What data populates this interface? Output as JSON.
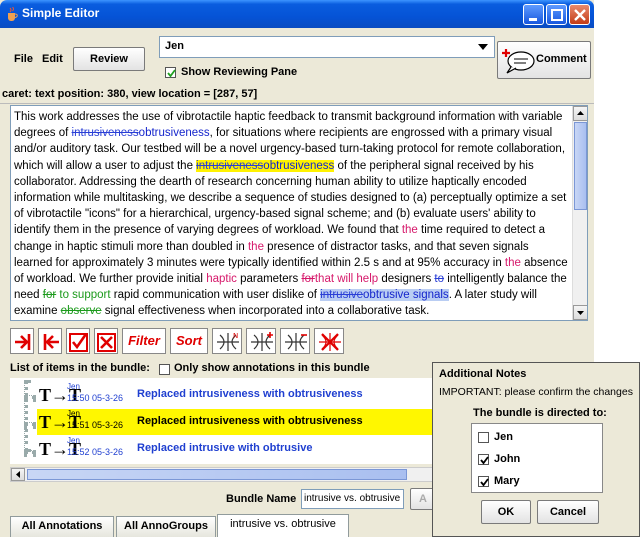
{
  "window": {
    "title": "Simple Editor"
  },
  "menu": {
    "file": "File",
    "edit": "Edit"
  },
  "toolbar": {
    "review_label": "Review",
    "user_select_value": "Jen",
    "show_reviewing_pane_label": "Show Reviewing Pane",
    "show_reviewing_pane_checked": true,
    "comment_label": "Comment"
  },
  "status": {
    "caret": "caret: text position: 380, view location = [287, 57]"
  },
  "editor": {
    "segments": [
      {
        "text": "This work addresses the use of vibrotactile haptic feedback to transmit background information with variable degrees of ",
        "style": "plain"
      },
      {
        "text": "intrusiveness",
        "style": "del"
      },
      {
        "text": "obtrusiveness",
        "style": "ins"
      },
      {
        "text": ", for situations where recipients are engrossed with a primary visual and/or auditory task. Our testbed will be a novel urgency-based turn-taking protocol for remote collaboration, which will allow a user to adjust the ",
        "style": "plain"
      },
      {
        "text": "intrusiveness",
        "style": "del-hl"
      },
      {
        "text": "obtrusiveness",
        "style": "ins-hl"
      },
      {
        "text": " of the peripheral signal received by his collaborator. Addressing the dearth of research concerning human ability to utilize haptically encoded information while multitasking, we describe a sequence of studies designed to (a) perceptually optimize a set of vibrotactile \"icons\" for a hierarchical, urgency-based signal scheme; and (b) evaluate users' ability to identify them in the presence of varying degrees of workload. We found that ",
        "style": "plain"
      },
      {
        "text": " the",
        "style": "mag"
      },
      {
        "text": " time required to detect a change in haptic stimuli more than doubled in ",
        "style": "plain"
      },
      {
        "text": " the",
        "style": "mag"
      },
      {
        "text": " presence of distractor tasks, and that seven signals learned for approximately 3 minutes were typically identified within 2.5 s and at 95% accuracy in ",
        "style": "plain"
      },
      {
        "text": " the",
        "style": "mag"
      },
      {
        "text": " absence of workload. We further provide initial ",
        "style": "plain"
      },
      {
        "text": "haptic",
        "style": "mag"
      },
      {
        "text": " parameters ",
        "style": "plain"
      },
      {
        "text": "for",
        "style": "mag-del"
      },
      {
        "text": "that will help",
        "style": "mag"
      },
      {
        "text": " designers ",
        "style": "plain"
      },
      {
        "text": "to",
        "style": "del"
      },
      {
        "text": " intelligently balance the need ",
        "style": "plain"
      },
      {
        "text": "for",
        "style": "green-del"
      },
      {
        "text": " to support ",
        "style": "green"
      },
      {
        "text": " rapid communication with user dislike of ",
        "style": "plain"
      },
      {
        "text": "intrusive",
        "style": "del-sel"
      },
      {
        "text": "obtrusive signals",
        "style": "ins-sel"
      },
      {
        "text": ". A later study will examine ",
        "style": "plain"
      },
      {
        "text": "observe",
        "style": "green-del"
      },
      {
        "text": " signal effectiveness when incorporated into a collaborative task.",
        "style": "plain"
      }
    ]
  },
  "icon_toolbar": {
    "filter_label": "Filter",
    "sort_label": "Sort",
    "icons": [
      "accept-next-icon",
      "reject-prev-icon",
      "accept-icon",
      "reject-icon",
      "bundle-icon",
      "bundle-add-icon",
      "bundle-remove-icon",
      "bundle-delete-icon"
    ]
  },
  "bundle_list": {
    "header": "List of items in the bundle:",
    "only_show_label": "Only show annotations in this bundle",
    "only_show_checked": false,
    "items": [
      {
        "glyph": "T→T",
        "user": "Jen",
        "time": "15:50 05-3-26",
        "description": "Replaced intrusiveness with obtrusiveness",
        "selected": false
      },
      {
        "glyph": "T→T",
        "user": "Jen",
        "time": "15:51 05-3-26",
        "description": "Replaced intrusiveness with obtrusiveness",
        "selected": true
      },
      {
        "glyph": "T→T",
        "user": "Jen",
        "time": "15:52 05-3-26",
        "description": "Replaced intrusive with obtrusive",
        "selected": false
      }
    ]
  },
  "bundle": {
    "name_label": "Bundle Name",
    "name_value": "intrusive vs. obtrusive",
    "apply_label": "A"
  },
  "tabs": [
    {
      "label": "All Annotations",
      "active": false
    },
    {
      "label": "All AnnoGroups",
      "active": false
    },
    {
      "label": "intrusive vs. obtrusive",
      "active": true
    }
  ],
  "notes_dialog": {
    "title": "Additional Notes",
    "message": "IMPORTANT: please confirm the changes",
    "directed_label": "The bundle is directed to:",
    "recipients": [
      {
        "name": "Jen",
        "checked": false
      },
      {
        "name": "John",
        "checked": true
      },
      {
        "name": "Mary",
        "checked": true
      }
    ],
    "ok_label": "OK",
    "cancel_label": "Cancel"
  },
  "colors": {
    "title_bar": "#0553d6",
    "deleted_text": "#2a3fd6",
    "inserted_text": "#1525cc",
    "highlight": "#fff200",
    "comment_magenta": "#d6176a",
    "comment_green": "#1b9a1b",
    "selected_item": "#fff700",
    "toolbar_red": "#e00000"
  }
}
